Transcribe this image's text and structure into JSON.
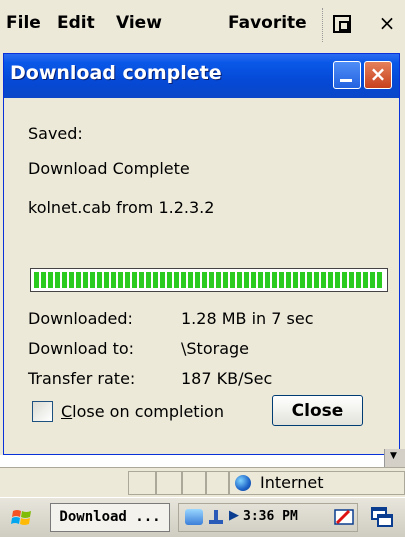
{
  "menubar": {
    "items": [
      {
        "label": "File"
      },
      {
        "label": "Edit"
      },
      {
        "label": "View"
      },
      {
        "label": "Favorite"
      }
    ],
    "close_glyph": "×"
  },
  "dialog": {
    "title": "Download complete",
    "close_glyph": "×",
    "saved_label": "Saved:",
    "status_text": "Download Complete",
    "file_text": "kolnet.cab from 1.2.3.2",
    "progress_percent": 100,
    "downloaded_label": "Downloaded:",
    "downloaded_value": "1.28 MB in 7 sec",
    "download_to_label": "Download to:",
    "download_to_value": "\\Storage",
    "transfer_rate_label": "Transfer rate:",
    "transfer_rate_value": "187 KB/Sec",
    "checkbox_label_first": "C",
    "checkbox_label_rest": "lose on completion",
    "checkbox_checked": false,
    "close_button_label": "Close"
  },
  "statusbar": {
    "zone_label": "Internet"
  },
  "taskbar": {
    "task_label": "Download ...",
    "clock": "3:36 PM"
  },
  "colors": {
    "titlebar": "#0549d6",
    "progress": "#2bcb1f",
    "close_red": "#c8401c"
  }
}
